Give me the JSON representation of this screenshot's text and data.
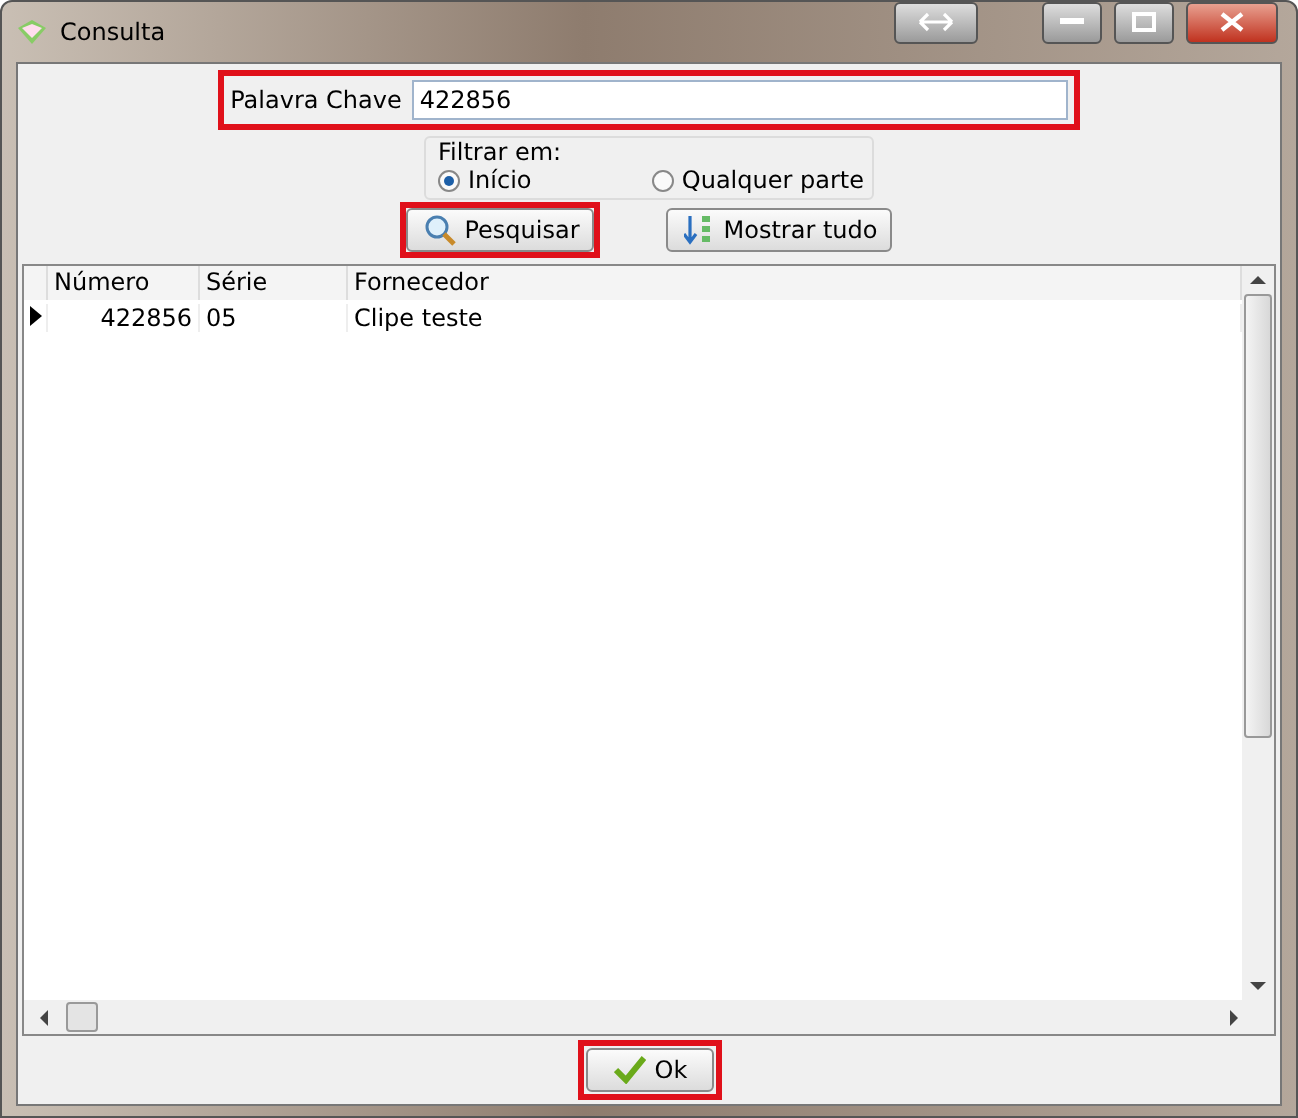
{
  "window": {
    "title": "Consulta"
  },
  "search": {
    "label": "Palavra Chave",
    "value": "422856",
    "highlighted": true
  },
  "filter": {
    "title": "Filtrar em:",
    "options": [
      {
        "label": "Início",
        "selected": true
      },
      {
        "label": "Qualquer parte",
        "selected": false
      }
    ]
  },
  "actions": [
    {
      "label": "Pesquisar",
      "kind": "search",
      "highlighted": true
    },
    {
      "label": "Mostrar tudo",
      "kind": "list",
      "highlighted": false
    }
  ],
  "table": {
    "columns": [
      "Número",
      "Série",
      "Fornecedor"
    ],
    "rows": [
      {
        "cells": [
          "422856",
          "05",
          "Clipe teste"
        ],
        "current": true
      }
    ]
  },
  "footer": {
    "label": "Ok",
    "kind": "ok",
    "highlighted": true
  }
}
